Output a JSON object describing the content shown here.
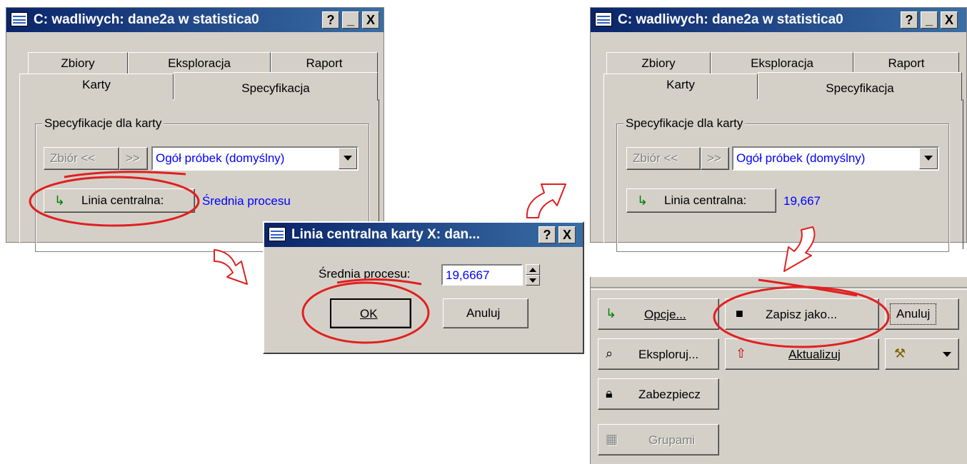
{
  "left_window": {
    "title": "C: wadliwych: dane2a w statistica0",
    "title_buttons": [
      "?",
      "_",
      "X"
    ],
    "tabs_back": [
      "Zbiory",
      "Eksploracja",
      "Raport"
    ],
    "tabs_front": [
      "Karty",
      "Specyfikacja"
    ],
    "group_label": "Specyfikacje dla karty",
    "prev_button": "Zbiór <<",
    "next_button": ">>",
    "sample_select": "Ogół próbek (domyślny)",
    "center_line_button": "Linia centralna:",
    "center_line_value": "Średnia procesu"
  },
  "dialog": {
    "title": "Linia centralna karty X: dan...",
    "title_buttons": [
      "?",
      "X"
    ],
    "field_label": "Średnia procesu:",
    "field_value": "19,6667",
    "ok": "OK",
    "cancel": "Anuluj"
  },
  "right_window": {
    "title": "C: wadliwych: dane2a w statistica0",
    "title_buttons": [
      "?",
      "_",
      "X"
    ],
    "tabs_back": [
      "Zbiory",
      "Eksploracja",
      "Raport"
    ],
    "tabs_front": [
      "Karty",
      "Specyfikacja"
    ],
    "group_label": "Specyfikacje dla karty",
    "prev_button": "Zbiór <<",
    "next_button": ">>",
    "sample_select": "Ogół próbek (domyślny)",
    "center_line_button": "Linia centralna:",
    "center_line_value": "19,667"
  },
  "right_panel": {
    "options": "Opcje...",
    "save_as": "Zapisz jako...",
    "cancel": "Anuluj",
    "explore": "Eksploruj...",
    "update": "Aktualizuj",
    "lock": "Zabezpiecz",
    "groups": "Grupami"
  },
  "colors": {
    "highlight_red": "#e02020",
    "title_blue": "#0a246a",
    "face": "#d4d0c8"
  }
}
